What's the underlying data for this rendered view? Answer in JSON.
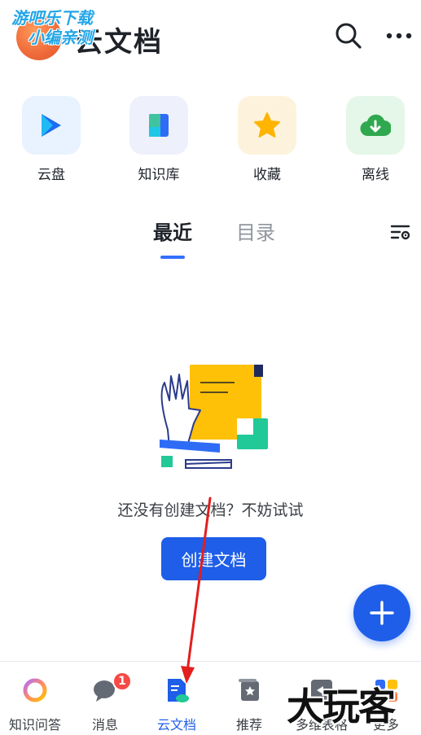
{
  "header": {
    "title": "云文档",
    "watermark_line1": "游吧乐下载",
    "watermark_line2": "小编亲测"
  },
  "quick_entries": [
    {
      "label": "云盘",
      "icon": "cloud-drive-icon",
      "bg": "#e8f3ff"
    },
    {
      "label": "知识库",
      "icon": "wiki-icon",
      "bg": "#eef1fb"
    },
    {
      "label": "收藏",
      "icon": "star-icon",
      "bg": "#fdf3dc"
    },
    {
      "label": "离线",
      "icon": "offline-download-icon",
      "bg": "#e4f7e8"
    }
  ],
  "tabs": {
    "recent": "最近",
    "catalog": "目录"
  },
  "empty_state": {
    "message": "还没有创建文档？不妨试试",
    "button": "创建文档"
  },
  "bottom_nav": [
    {
      "label": "知识问答",
      "icon": "ai-ring-icon"
    },
    {
      "label": "消息",
      "icon": "chat-bubble-icon",
      "badge": "1"
    },
    {
      "label": "云文档",
      "icon": "document-icon",
      "active": true
    },
    {
      "label": "推荐",
      "icon": "recommend-icon"
    },
    {
      "label": "多维表格",
      "icon": "bitable-icon"
    },
    {
      "label": "更多",
      "icon": "more-apps-icon"
    }
  ],
  "watermark_bottom": "大玩客",
  "colors": {
    "accent": "#1e5ee8",
    "badge": "#f54a45",
    "annotation_arrow": "#e21e1e"
  }
}
